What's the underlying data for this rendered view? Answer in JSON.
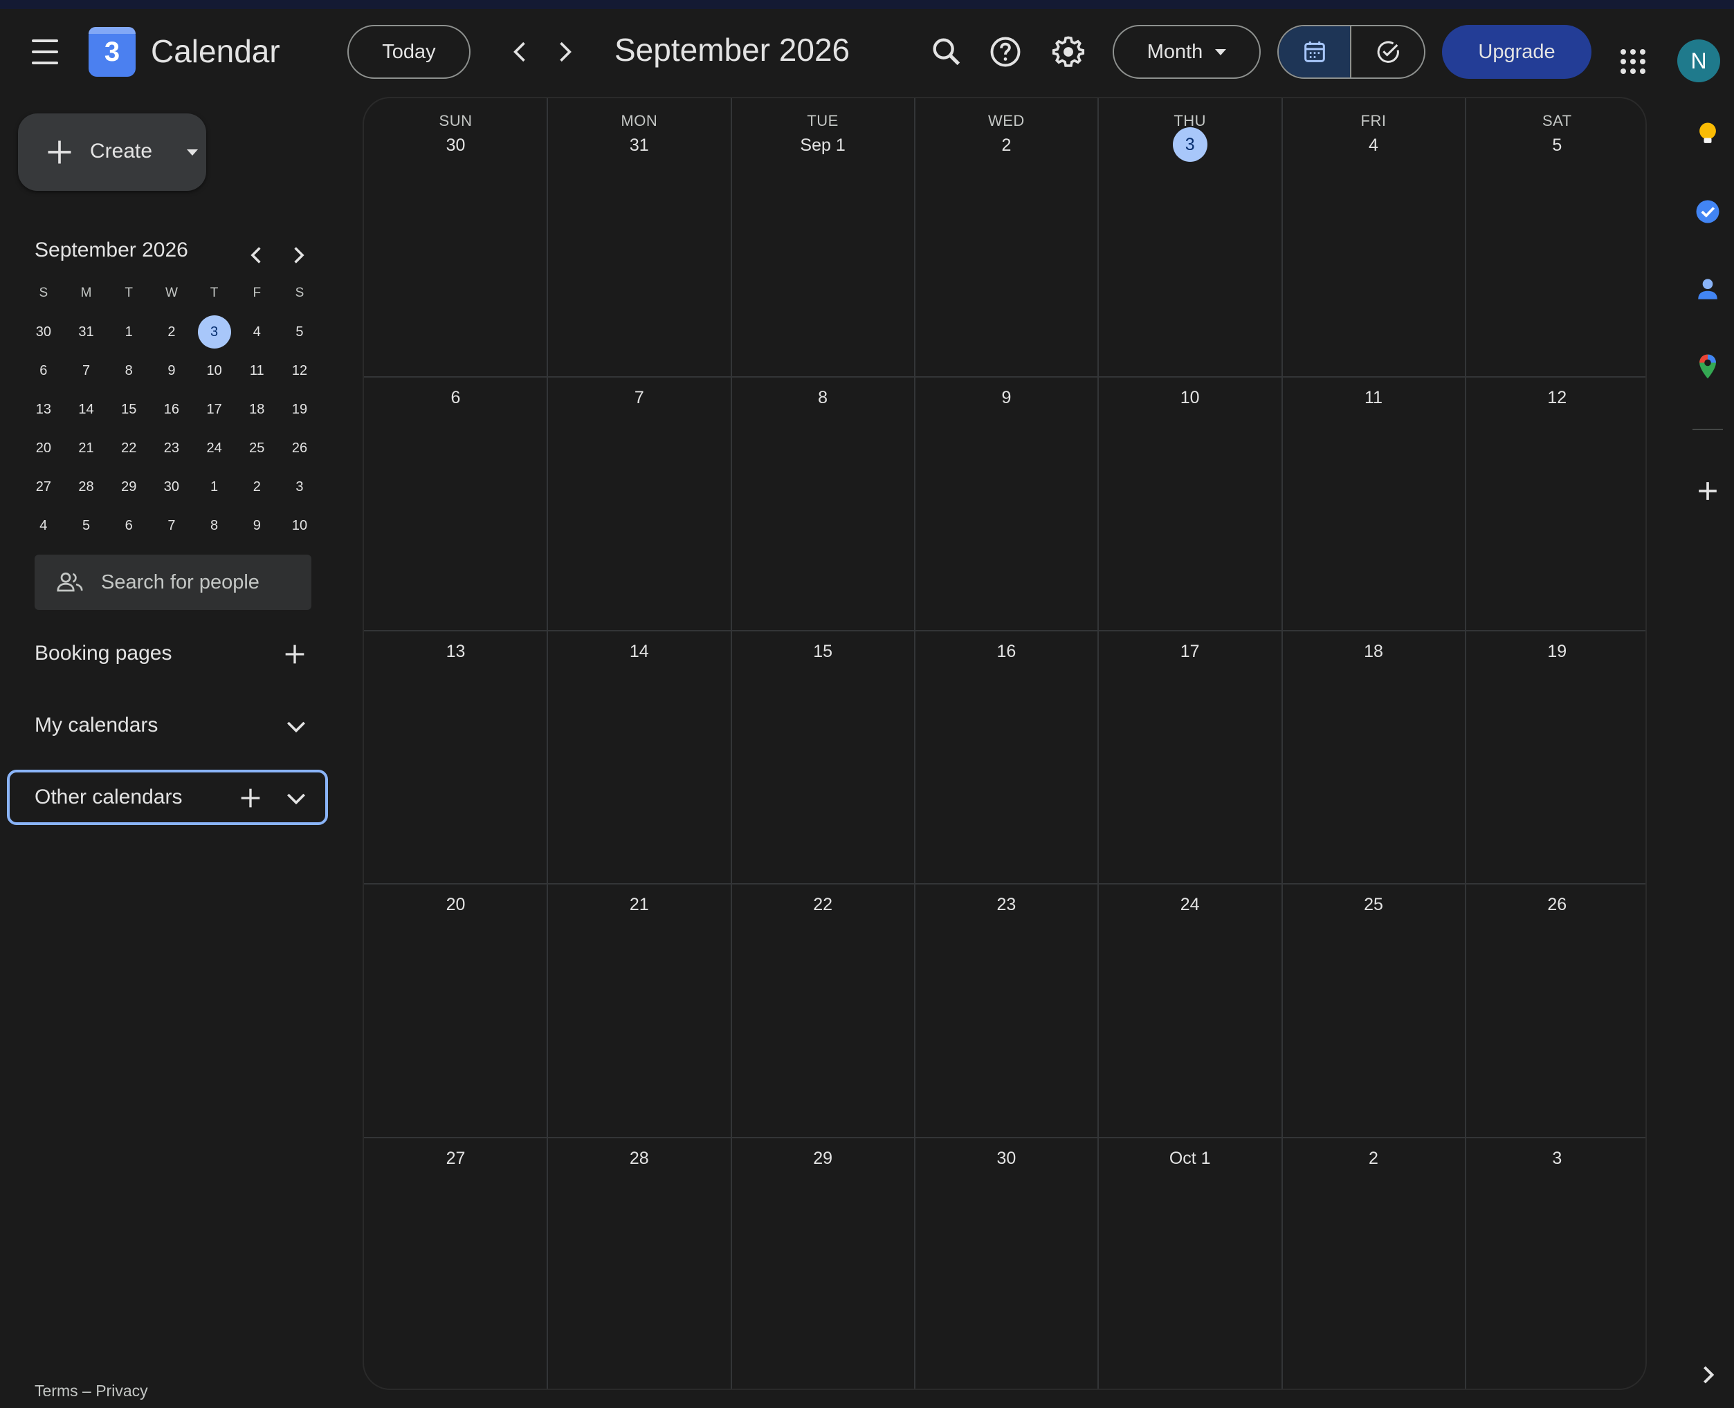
{
  "app": {
    "title": "Calendar",
    "logo_number": "3"
  },
  "header": {
    "today_label": "Today",
    "month_title": "September 2026",
    "view_label": "Month",
    "upgrade_label": "Upgrade",
    "avatar_initial": "N"
  },
  "sidebar": {
    "create_label": "Create",
    "mini_calendar": {
      "title": "September 2026",
      "weekdays": [
        "S",
        "M",
        "T",
        "W",
        "T",
        "F",
        "S"
      ],
      "weeks": [
        [
          "30",
          "31",
          "1",
          "2",
          "3",
          "4",
          "5"
        ],
        [
          "6",
          "7",
          "8",
          "9",
          "10",
          "11",
          "12"
        ],
        [
          "13",
          "14",
          "15",
          "16",
          "17",
          "18",
          "19"
        ],
        [
          "20",
          "21",
          "22",
          "23",
          "24",
          "25",
          "26"
        ],
        [
          "27",
          "28",
          "29",
          "30",
          "1",
          "2",
          "3"
        ],
        [
          "4",
          "5",
          "6",
          "7",
          "8",
          "9",
          "10"
        ]
      ],
      "today": "3"
    },
    "people_search_placeholder": "Search for people",
    "booking_pages_label": "Booking pages",
    "my_calendars_label": "My calendars",
    "other_calendars_label": "Other calendars"
  },
  "grid": {
    "weekdays": [
      "SUN",
      "MON",
      "TUE",
      "WED",
      "THU",
      "FRI",
      "SAT"
    ],
    "weeks": [
      [
        "30",
        "31",
        "Sep 1",
        "2",
        "3",
        "4",
        "5"
      ],
      [
        "6",
        "7",
        "8",
        "9",
        "10",
        "11",
        "12"
      ],
      [
        "13",
        "14",
        "15",
        "16",
        "17",
        "18",
        "19"
      ],
      [
        "20",
        "21",
        "22",
        "23",
        "24",
        "25",
        "26"
      ],
      [
        "27",
        "28",
        "29",
        "30",
        "Oct 1",
        "2",
        "3"
      ]
    ],
    "today": "3"
  },
  "footer": {
    "terms": "Terms",
    "separator": "–",
    "privacy": "Privacy"
  },
  "colors": {
    "background": "#1b1b1b",
    "today_highlight": "#a8c7fa",
    "upgrade": "#233d96",
    "focus_ring": "#8ab4f8",
    "avatar": "#1f7a8c"
  },
  "icons": {
    "header": [
      "menu-icon",
      "search-icon",
      "help-icon",
      "settings-icon",
      "calendar-view-icon",
      "tasks-view-icon",
      "apps-grid-icon"
    ],
    "rail": [
      "keep-icon",
      "tasks-icon",
      "contacts-icon",
      "maps-icon",
      "add-addon-icon",
      "expand-panel-icon"
    ]
  }
}
